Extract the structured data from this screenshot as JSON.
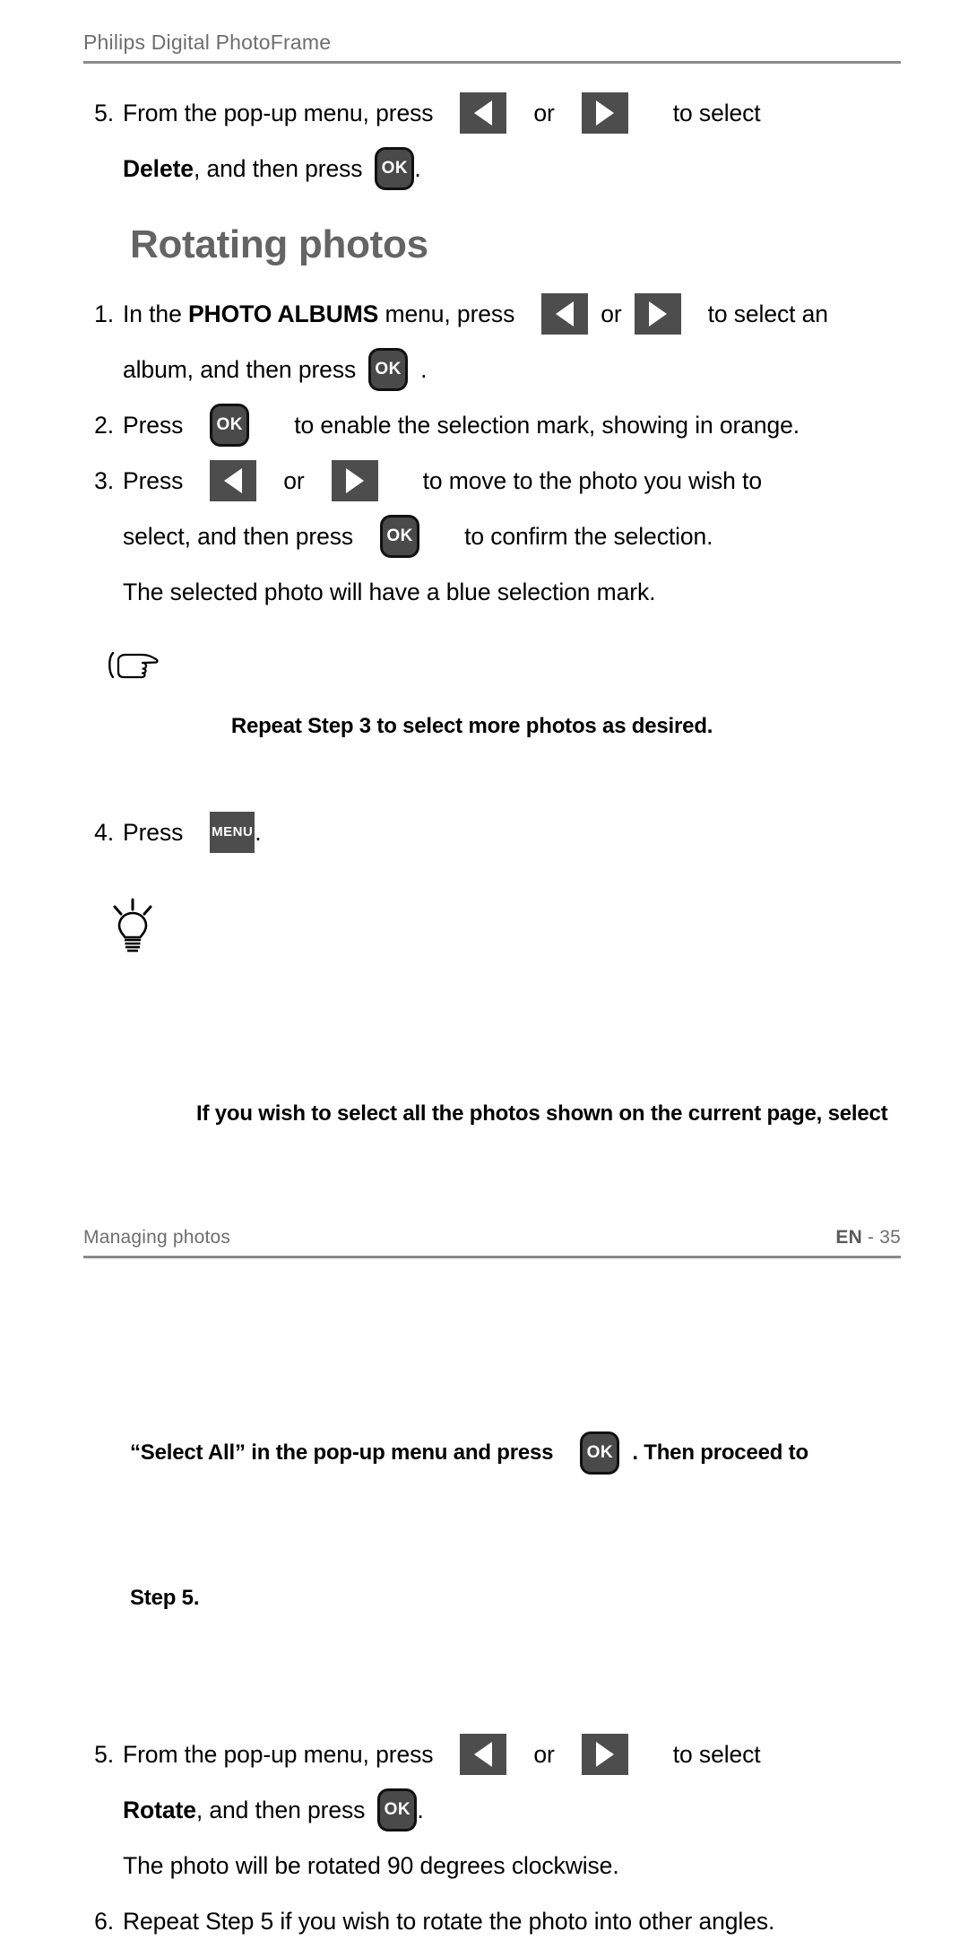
{
  "header": {
    "title": "Philips Digital PhotoFrame"
  },
  "delete_step": {
    "number": "5.",
    "line1_a": "From the pop-up menu, press",
    "line1_or": "or",
    "line1_b": "to select",
    "line2_bold": "Delete",
    "line2_a": ", and then press",
    "line2_end": "."
  },
  "section": {
    "heading": "Rotating photos"
  },
  "steps": [
    {
      "number": "1.",
      "line1_a": "In the ",
      "line1_bold": "PHOTO ALBUMS",
      "line1_b": " menu, press",
      "line1_or": "or",
      "line1_c": "to select an",
      "line2_a": "album, and then press",
      "line2_end": "."
    },
    {
      "number": "2.",
      "line1_a": "Press",
      "line1_b": "to enable the selection mark, showing in orange."
    },
    {
      "number": "3.",
      "line1_a": "Press",
      "line1_or": "or",
      "line1_b": "to move to the photo you wish to",
      "line2_a": "select, and then press",
      "line2_b": "to confirm the selection.",
      "line3": "The selected photo will have a blue selection mark."
    },
    {
      "number": "4.",
      "line1_a": "Press",
      "line1_end": "."
    },
    {
      "number": "5.",
      "line1_a": "From the pop-up menu, press",
      "line1_or": "or",
      "line1_b": "to select",
      "line2_bold": "Rotate",
      "line2_a": ", and then press",
      "line2_end": ".",
      "line3": "The photo will be rotated 90 degrees clockwise."
    },
    {
      "number": "6.",
      "line1_a": "Repeat Step 5 if you wish to rotate the photo into other angles."
    }
  ],
  "note_hand": {
    "text": "Repeat Step 3 to select more photos as desired."
  },
  "note_bulb": {
    "line1": "If you wish to select all the photos shown on the current page, select",
    "line2_a": "“Select All” in the pop-up menu and press",
    "line2_b": ". Then proceed to",
    "line3": "Step 5."
  },
  "keys": {
    "ok_label": "OK",
    "menu_label": "MENU"
  },
  "footer": {
    "left": "Managing photos",
    "lang": "EN",
    "separator": " - ",
    "page": "35"
  },
  "colors": {
    "key_fill": "#4d4d4d",
    "heading_gray": "#646464",
    "rule_gray": "#8a8a8a",
    "text_black": "#000000"
  }
}
